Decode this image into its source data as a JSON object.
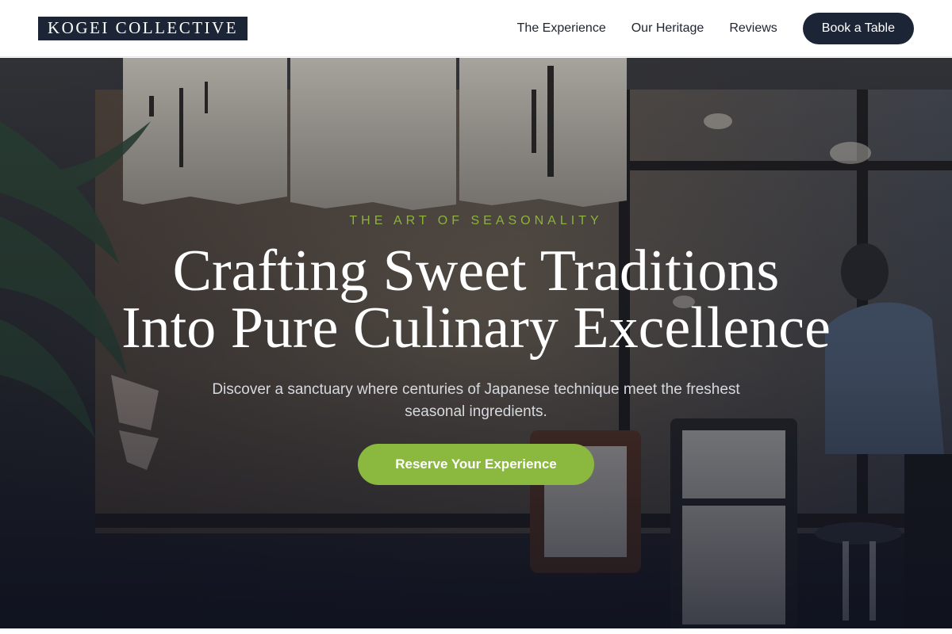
{
  "header": {
    "logo": "KOGEI COLLECTIVE",
    "nav": [
      {
        "label": "The Experience"
      },
      {
        "label": "Our Heritage"
      },
      {
        "label": "Reviews"
      }
    ],
    "cta_label": "Book a Table"
  },
  "hero": {
    "eyebrow": "THE ART OF SEASONALITY",
    "headline_line1": "Crafting Sweet Traditions",
    "headline_line2": "Into Pure Culinary Excellence",
    "subtext": "Discover a sanctuary where centuries of Japanese technique meet the freshest seasonal ingredients.",
    "cta_label": "Reserve Your Experience"
  },
  "colors": {
    "brand_dark": "#1c2535",
    "accent_green": "#8bb83e",
    "eyebrow_green": "#8cb23b"
  }
}
